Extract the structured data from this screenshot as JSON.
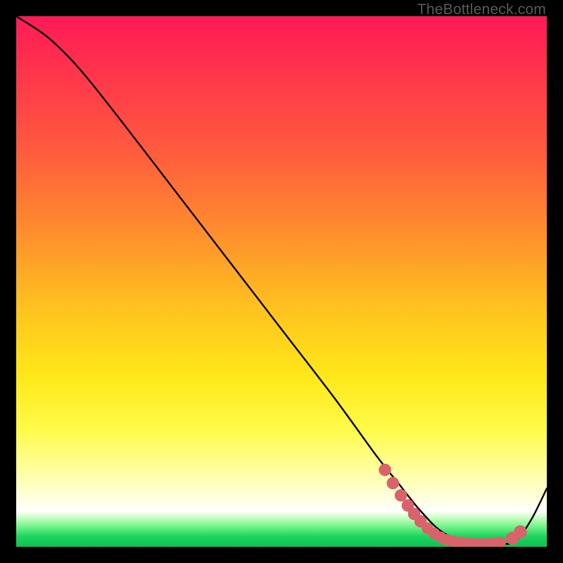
{
  "watermark": "TheBottleneck.com",
  "chart_data": {
    "type": "line",
    "title": "",
    "xlabel": "",
    "ylabel": "",
    "xlim": [
      0,
      100
    ],
    "ylim": [
      0,
      100
    ],
    "series": [
      {
        "name": "bottleneck-curve",
        "x": [
          0,
          6,
          12,
          20,
          30,
          40,
          50,
          60,
          68,
          72,
          76,
          80,
          84,
          88,
          91,
          94,
          97,
          100
        ],
        "y": [
          100,
          96,
          90,
          80,
          67,
          54,
          41,
          28,
          17,
          12,
          7,
          3,
          1.2,
          0.6,
          0.6,
          1.0,
          5,
          11
        ]
      }
    ],
    "markers": {
      "name": "highlight-dots",
      "color": "#d9626b",
      "points": [
        {
          "x": 69.5,
          "y": 14.5,
          "r": 1.1
        },
        {
          "x": 71.0,
          "y": 12.0,
          "r": 1.1
        },
        {
          "x": 72.5,
          "y": 9.7,
          "r": 1.1
        },
        {
          "x": 73.8,
          "y": 7.8,
          "r": 1.1
        },
        {
          "x": 75.0,
          "y": 6.2,
          "r": 1.1
        },
        {
          "x": 76.2,
          "y": 4.8,
          "r": 1.1
        },
        {
          "x": 77.5,
          "y": 3.5,
          "r": 1.0
        },
        {
          "x": 78.8,
          "y": 2.5,
          "r": 1.0
        },
        {
          "x": 80.0,
          "y": 1.8,
          "r": 1.0
        },
        {
          "x": 81.2,
          "y": 1.3,
          "r": 1.0
        },
        {
          "x": 82.5,
          "y": 1.0,
          "r": 1.0
        },
        {
          "x": 83.8,
          "y": 0.8,
          "r": 1.0
        },
        {
          "x": 85.0,
          "y": 0.7,
          "r": 1.0
        },
        {
          "x": 86.2,
          "y": 0.6,
          "r": 1.0
        },
        {
          "x": 87.5,
          "y": 0.6,
          "r": 1.0
        },
        {
          "x": 88.8,
          "y": 0.6,
          "r": 1.0
        },
        {
          "x": 90.0,
          "y": 0.7,
          "r": 1.0
        },
        {
          "x": 91.2,
          "y": 0.8,
          "r": 1.0
        },
        {
          "x": 93.5,
          "y": 1.6,
          "r": 1.2
        },
        {
          "x": 95.0,
          "y": 2.8,
          "r": 1.2
        }
      ]
    }
  }
}
